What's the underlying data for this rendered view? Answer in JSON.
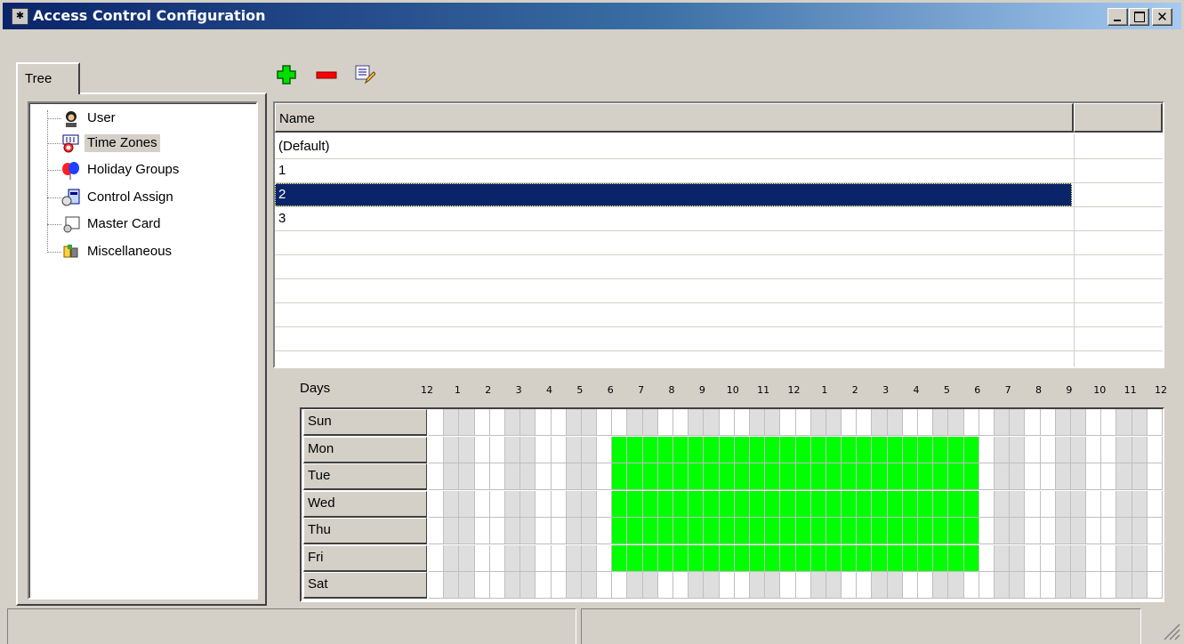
{
  "window": {
    "title": "Access Control Configuration",
    "close_glyph": "✕"
  },
  "tabs": [
    {
      "label": "Tree"
    }
  ],
  "tree": {
    "items": [
      {
        "label": "User",
        "icon": "user-icon"
      },
      {
        "label": "Time Zones",
        "icon": "time-zones-icon",
        "selected": true
      },
      {
        "label": "Holiday Groups",
        "icon": "holiday-groups-icon"
      },
      {
        "label": "Control Assign",
        "icon": "control-assign-icon"
      },
      {
        "label": "Master Card",
        "icon": "master-card-icon"
      },
      {
        "label": "Miscellaneous",
        "icon": "miscellaneous-icon"
      }
    ]
  },
  "toolbar": {
    "add_icon": "add-icon",
    "remove_icon": "remove-icon",
    "edit_icon": "edit-icon"
  },
  "list": {
    "column_header": "Name",
    "rows": [
      {
        "name": "(Default)"
      },
      {
        "name": "1"
      },
      {
        "name": "2",
        "selected": true
      },
      {
        "name": "3"
      }
    ]
  },
  "schedule": {
    "days_label": "Days",
    "hour_labels": [
      "12",
      "1",
      "2",
      "3",
      "4",
      "5",
      "6",
      "7",
      "8",
      "9",
      "10",
      "11",
      "12",
      "1",
      "2",
      "3",
      "4",
      "5",
      "6",
      "7",
      "8",
      "9",
      "10",
      "11",
      "12"
    ],
    "days": [
      "Sun",
      "Mon",
      "Tue",
      "Wed",
      "Thu",
      "Fri",
      "Sat"
    ],
    "slots_per_day": 48,
    "active_color": "#00ff00",
    "shaded_color": "#dedede",
    "active": {
      "Sun": [],
      "Mon": [
        12,
        35
      ],
      "Tue": [
        12,
        35
      ],
      "Wed": [
        12,
        35
      ],
      "Thu": [
        12,
        35
      ],
      "Fri": [
        12,
        35
      ],
      "Sat": []
    }
  },
  "colors": {
    "title_gradient_start": "#0a246a",
    "title_gradient_end": "#a6caf0",
    "selection": "#0a246a",
    "face": "#d4d0c8"
  }
}
